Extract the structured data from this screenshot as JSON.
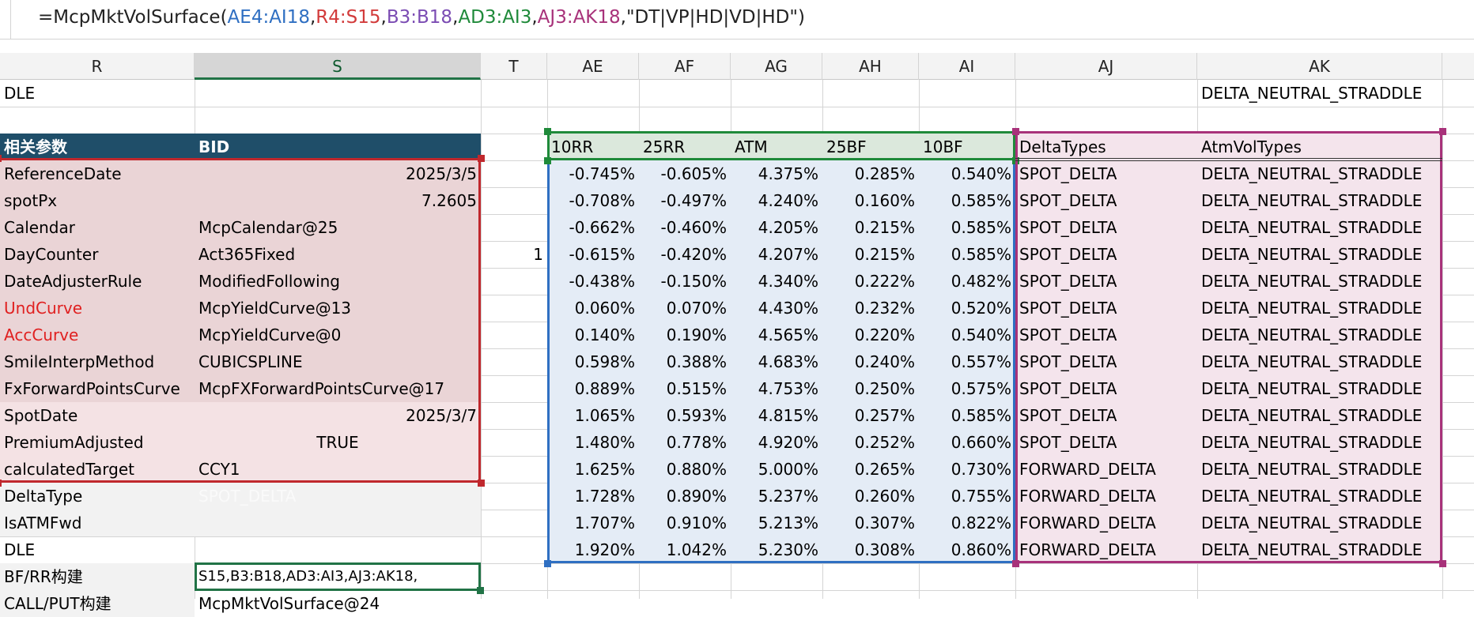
{
  "formula_bar": {
    "tokens": [
      {
        "text": "=McpMktVolSurface(",
        "color": "#222222"
      },
      {
        "text": "AE4:AI18",
        "color": "#2f6fc2"
      },
      {
        "text": ",",
        "color": "#222222"
      },
      {
        "text": "R4:S15",
        "color": "#d23b3b"
      },
      {
        "text": ",",
        "color": "#222222"
      },
      {
        "text": "B3:B18",
        "color": "#7b4cb3"
      },
      {
        "text": ",",
        "color": "#222222"
      },
      {
        "text": "AD3:AI3",
        "color": "#1f8a3a"
      },
      {
        "text": ",",
        "color": "#222222"
      },
      {
        "text": "AJ3:AK18",
        "color": "#a8327a"
      },
      {
        "text": ",\"DT|VP|HD|VD|HD\")",
        "color": "#222222"
      }
    ]
  },
  "columns": [
    "R",
    "S",
    "T",
    "AE",
    "AF",
    "AG",
    "AH",
    "AI",
    "AJ",
    "AK"
  ],
  "colors": {
    "param_border": "#c0282d",
    "vol_border": "#2f6fc2",
    "header_border": "#1f8a3a",
    "types_border": "#a8327a",
    "header_fill": "#1f4e69"
  },
  "rows": {
    "row1": {
      "r": "DLE",
      "ak": "DELTA_NEUTRAL_STRADDLE"
    },
    "params_header": {
      "label": "相关参数",
      "value": "BID"
    },
    "params": [
      {
        "name": "ReferenceDate",
        "value": "2025/3/5",
        "align": "right",
        "red": false
      },
      {
        "name": "spotPx",
        "value": "7.2605",
        "align": "right",
        "red": false
      },
      {
        "name": "Calendar",
        "value": "McpCalendar@25",
        "align": "left",
        "red": false
      },
      {
        "name": "DayCounter",
        "value": "Act365Fixed",
        "align": "left",
        "red": false
      },
      {
        "name": "DateAdjusterRule",
        "value": "ModifiedFollowing",
        "align": "left",
        "red": false
      },
      {
        "name": "UndCurve",
        "value": "McpYieldCurve@13",
        "align": "left",
        "red": true
      },
      {
        "name": "AccCurve",
        "value": "McpYieldCurve@0",
        "align": "left",
        "red": true
      },
      {
        "name": "SmileInterpMethod",
        "value": "CUBICSPLINE",
        "align": "left",
        "red": false
      },
      {
        "name": "FxForwardPointsCurve",
        "value": "McpFXForwardPointsCurve@17",
        "align": "left",
        "red": false
      },
      {
        "name": "SpotDate",
        "value": "2025/3/7",
        "align": "right",
        "red": false
      },
      {
        "name": "PremiumAdjusted",
        "value": "TRUE",
        "align": "center",
        "red": false
      },
      {
        "name": "calculatedTarget",
        "value": "CCY1",
        "align": "left",
        "red": false
      },
      {
        "name": "DeltaType",
        "value": "SPOT_DELTA",
        "align": "left",
        "red": false
      },
      {
        "name": "IsATMFwd",
        "value": "",
        "align": "left",
        "red": false
      }
    ],
    "t_value": "1",
    "after": [
      {
        "r": "DLE",
        "s": ""
      },
      {
        "r": "BF/RR构建",
        "s": "S15,B3:B18,AD3:AI3,AJ3:AK18,"
      },
      {
        "r": "CALL/PUT构建",
        "s": "McpMktVolSurface@24"
      }
    ]
  },
  "vol_table": {
    "headers": [
      "10RR",
      "25RR",
      "ATM",
      "25BF",
      "10BF"
    ],
    "type_headers": [
      "DeltaTypes",
      "AtmVolTypes"
    ],
    "rows": [
      [
        "-0.745%",
        "-0.605%",
        "4.375%",
        "0.285%",
        "0.540%",
        "SPOT_DELTA",
        "DELTA_NEUTRAL_STRADDLE"
      ],
      [
        "-0.708%",
        "-0.497%",
        "4.240%",
        "0.160%",
        "0.585%",
        "SPOT_DELTA",
        "DELTA_NEUTRAL_STRADDLE"
      ],
      [
        "-0.662%",
        "-0.460%",
        "4.205%",
        "0.215%",
        "0.585%",
        "SPOT_DELTA",
        "DELTA_NEUTRAL_STRADDLE"
      ],
      [
        "-0.615%",
        "-0.420%",
        "4.207%",
        "0.215%",
        "0.585%",
        "SPOT_DELTA",
        "DELTA_NEUTRAL_STRADDLE"
      ],
      [
        "-0.438%",
        "-0.150%",
        "4.340%",
        "0.222%",
        "0.482%",
        "SPOT_DELTA",
        "DELTA_NEUTRAL_STRADDLE"
      ],
      [
        "0.060%",
        "0.070%",
        "4.430%",
        "0.232%",
        "0.520%",
        "SPOT_DELTA",
        "DELTA_NEUTRAL_STRADDLE"
      ],
      [
        "0.140%",
        "0.190%",
        "4.565%",
        "0.220%",
        "0.540%",
        "SPOT_DELTA",
        "DELTA_NEUTRAL_STRADDLE"
      ],
      [
        "0.598%",
        "0.388%",
        "4.683%",
        "0.240%",
        "0.557%",
        "SPOT_DELTA",
        "DELTA_NEUTRAL_STRADDLE"
      ],
      [
        "0.889%",
        "0.515%",
        "4.753%",
        "0.250%",
        "0.575%",
        "SPOT_DELTA",
        "DELTA_NEUTRAL_STRADDLE"
      ],
      [
        "1.065%",
        "0.593%",
        "4.815%",
        "0.257%",
        "0.585%",
        "SPOT_DELTA",
        "DELTA_NEUTRAL_STRADDLE"
      ],
      [
        "1.480%",
        "0.778%",
        "4.920%",
        "0.252%",
        "0.660%",
        "SPOT_DELTA",
        "DELTA_NEUTRAL_STRADDLE"
      ],
      [
        "1.625%",
        "0.880%",
        "5.000%",
        "0.265%",
        "0.730%",
        "FORWARD_DELTA",
        "DELTA_NEUTRAL_STRADDLE"
      ],
      [
        "1.728%",
        "0.890%",
        "5.237%",
        "0.260%",
        "0.755%",
        "FORWARD_DELTA",
        "DELTA_NEUTRAL_STRADDLE"
      ],
      [
        "1.707%",
        "0.910%",
        "5.213%",
        "0.307%",
        "0.822%",
        "FORWARD_DELTA",
        "DELTA_NEUTRAL_STRADDLE"
      ],
      [
        "1.920%",
        "1.042%",
        "5.230%",
        "0.308%",
        "0.860%",
        "FORWARD_DELTA",
        "DELTA_NEUTRAL_STRADDLE"
      ]
    ]
  }
}
